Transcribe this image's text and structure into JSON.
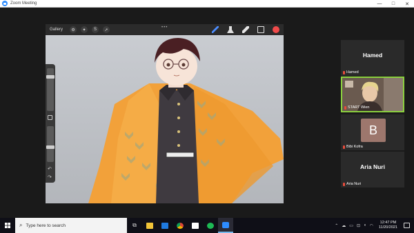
{
  "window": {
    "title": "Zoom Meeting",
    "controls": [
      "—",
      "□",
      "✕"
    ]
  },
  "procreate": {
    "gallery_label": "Gallery",
    "tools_left": [
      "wrench-icon",
      "wand-icon",
      "selection-icon",
      "transform-icon"
    ],
    "more_dots": "•••",
    "tools_right": [
      "brush-icon",
      "smudge-icon",
      "eraser-icon",
      "layers-icon",
      "color-icon"
    ],
    "active_color": "#f04a4a",
    "undo_glyph": "↶",
    "redo_glyph": "↷"
  },
  "participants": [
    {
      "display": "Hamed",
      "label": "Hamed",
      "muted": true,
      "video": false
    },
    {
      "display": "",
      "label": "START Wien",
      "muted": true,
      "video": true,
      "active_speaker": true
    },
    {
      "display": "B",
      "label": "Bibi Kofra",
      "muted": true,
      "video": false,
      "avatar_color": "#9d776d"
    },
    {
      "display": "Aria Nuri",
      "label": "Aria Nuri",
      "muted": true,
      "video": false
    }
  ],
  "taskbar": {
    "search_placeholder": "Type here to search",
    "apps": [
      "task-view-icon",
      "file-explorer-icon",
      "mail-icon",
      "chrome-icon",
      "notion-icon",
      "spotify-icon",
      "zoom-icon"
    ],
    "time": "12:47 PM",
    "date": "11/20/2021"
  }
}
